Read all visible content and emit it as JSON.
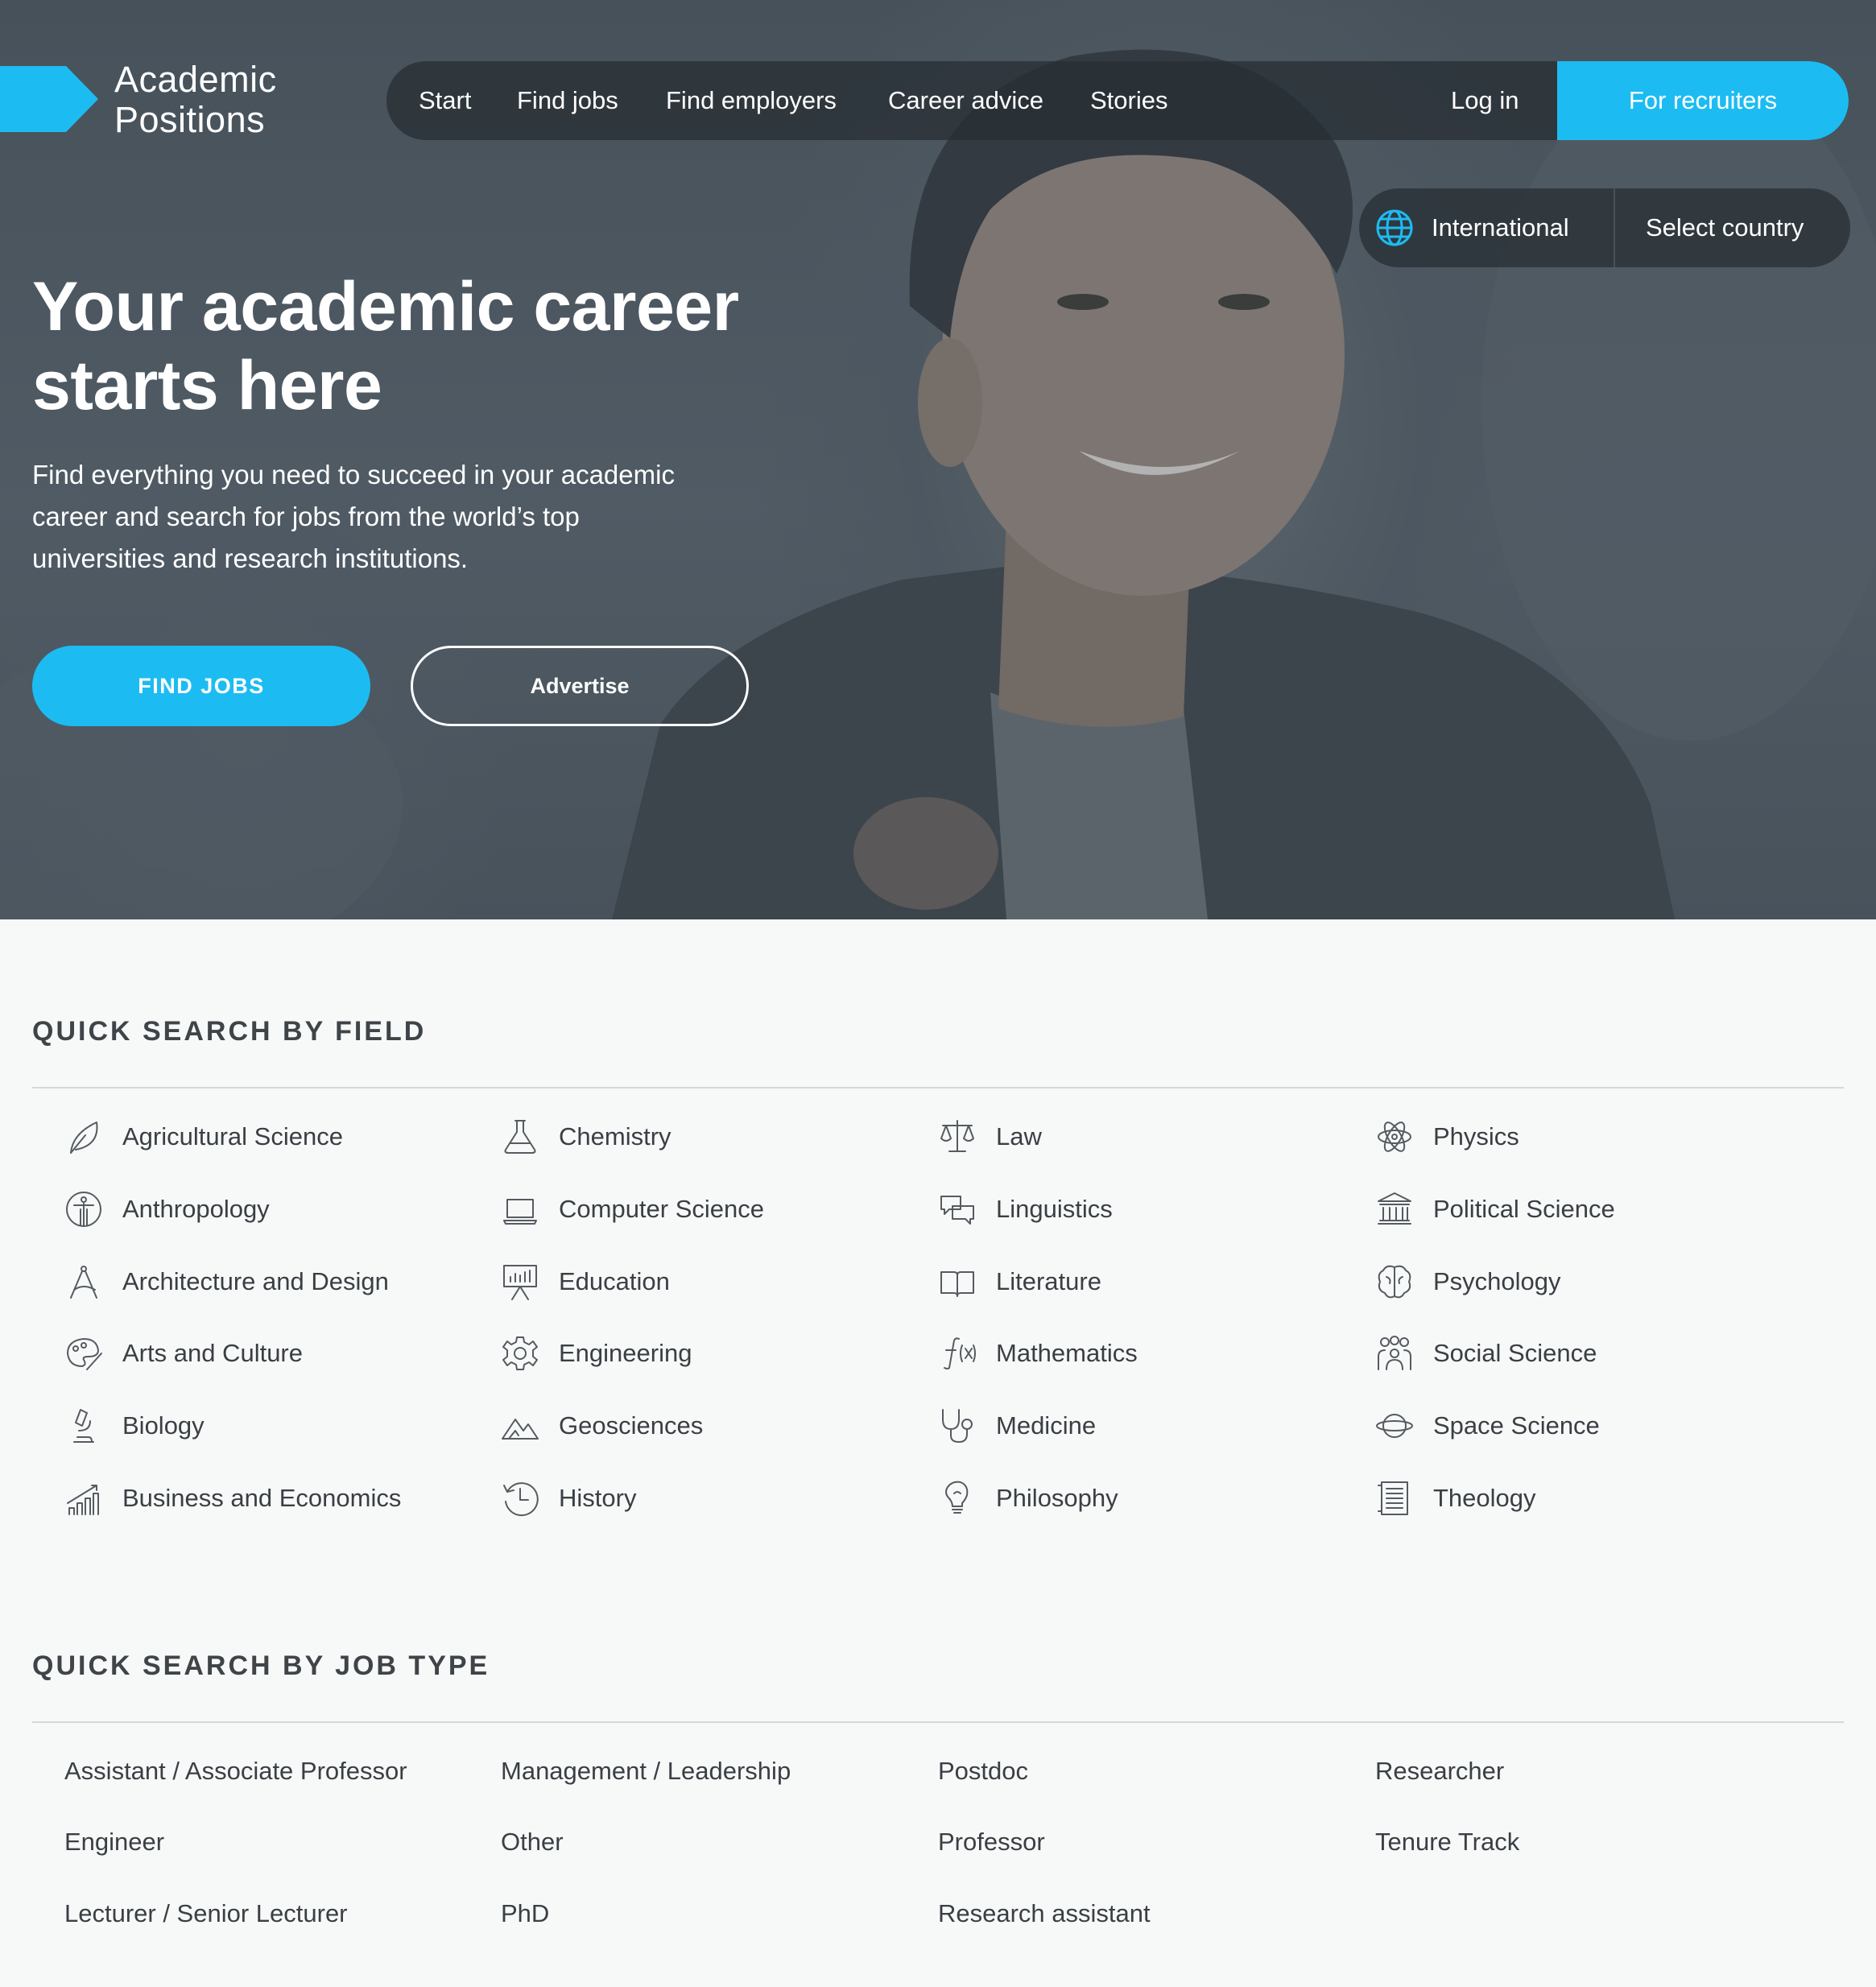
{
  "brand": {
    "line1": "Academic",
    "line2": "Positions",
    "accent": "#1cbcf2"
  },
  "nav": {
    "start": "Start",
    "find_jobs": "Find jobs",
    "find_employers": "Find employers",
    "career_advice": "Career advice",
    "stories": "Stories",
    "login": "Log in",
    "recruiters": "For recruiters"
  },
  "country": {
    "region": "International",
    "select": "Select country",
    "icon": "globe-icon"
  },
  "hero": {
    "title_line1": "Your academic career",
    "title_line2": "starts here",
    "sub_line1": "Find everything you need to succeed in your academic",
    "sub_line2": "career and search for jobs from the world’s top",
    "sub_line3": "universities and research institutions.",
    "find_jobs": "FIND JOBS",
    "advertise": "Advertise"
  },
  "fields": {
    "title": "QUICK SEARCH BY FIELD",
    "items": [
      {
        "label": "Agricultural Science",
        "icon": "leaf-icon"
      },
      {
        "label": "Anthropology",
        "icon": "human-figure-icon"
      },
      {
        "label": "Architecture and Design",
        "icon": "compass-drawing-icon"
      },
      {
        "label": "Arts and Culture",
        "icon": "palette-icon"
      },
      {
        "label": "Biology",
        "icon": "microscope-icon"
      },
      {
        "label": "Business and Economics",
        "icon": "bar-chart-icon"
      },
      {
        "label": "Chemistry",
        "icon": "flask-icon"
      },
      {
        "label": "Computer Science",
        "icon": "laptop-icon"
      },
      {
        "label": "Education",
        "icon": "presentation-board-icon"
      },
      {
        "label": "Engineering",
        "icon": "gear-icon"
      },
      {
        "label": "Geosciences",
        "icon": "mountains-icon"
      },
      {
        "label": "History",
        "icon": "history-clock-icon"
      },
      {
        "label": "Law",
        "icon": "scales-icon"
      },
      {
        "label": "Linguistics",
        "icon": "speech-bubbles-icon"
      },
      {
        "label": "Literature",
        "icon": "open-book-icon"
      },
      {
        "label": "Mathematics",
        "icon": "function-icon"
      },
      {
        "label": "Medicine",
        "icon": "stethoscope-icon"
      },
      {
        "label": "Philosophy",
        "icon": "lightbulb-icon"
      },
      {
        "label": "Physics",
        "icon": "atom-icon"
      },
      {
        "label": "Political Science",
        "icon": "government-building-icon"
      },
      {
        "label": "Psychology",
        "icon": "brain-icon"
      },
      {
        "label": "Social Science",
        "icon": "people-group-icon"
      },
      {
        "label": "Space Science",
        "icon": "planet-icon"
      },
      {
        "label": "Theology",
        "icon": "scripture-icon"
      }
    ]
  },
  "job_types": {
    "title": "QUICK SEARCH BY JOB TYPE",
    "items": [
      "Assistant / Associate Professor",
      "Engineer",
      "Lecturer / Senior Lecturer",
      "Management / Leadership",
      "Other",
      "PhD",
      "Postdoc",
      "Professor",
      "Research assistant",
      "Researcher",
      "Tenure Track"
    ]
  }
}
